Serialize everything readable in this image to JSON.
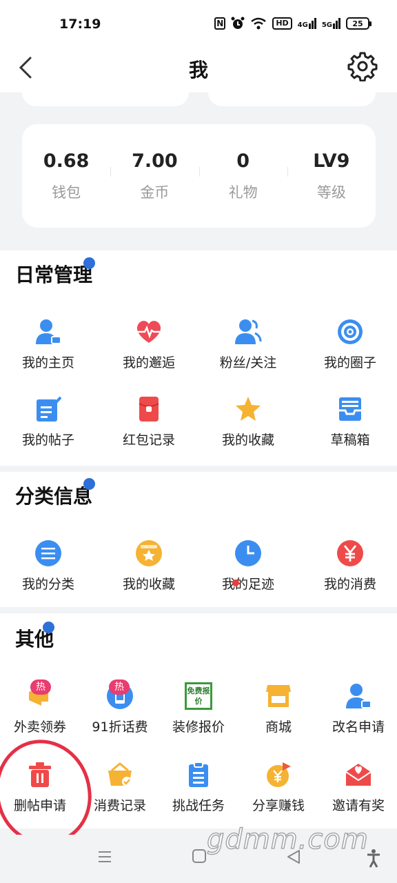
{
  "status_bar": {
    "time": "17:19",
    "hd_badge": "HD",
    "net1": "4G",
    "net2": "5G",
    "battery": "25"
  },
  "header": {
    "title": "我",
    "back_icon": "chevron-left-icon",
    "settings_icon": "gear-icon"
  },
  "stats": [
    {
      "value": "0.68",
      "label": "钱包"
    },
    {
      "value": "7.00",
      "label": "金币"
    },
    {
      "value": "0",
      "label": "礼物"
    },
    {
      "value": "LV9",
      "label": "等级"
    }
  ],
  "daily": {
    "title": "日常管理",
    "items": [
      {
        "label": "我的主页",
        "icon": "user-home-icon"
      },
      {
        "label": "我的邂逅",
        "icon": "heartbeat-icon"
      },
      {
        "label": "粉丝/关注",
        "icon": "fans-icon"
      },
      {
        "label": "我的圈子",
        "icon": "circle-target-icon"
      },
      {
        "label": "我的帖子",
        "icon": "edit-post-icon"
      },
      {
        "label": "红包记录",
        "icon": "red-envelope-icon"
      },
      {
        "label": "我的收藏",
        "icon": "star-icon"
      },
      {
        "label": "草稿箱",
        "icon": "inbox-tray-icon"
      }
    ]
  },
  "category": {
    "title": "分类信息",
    "items": [
      {
        "label": "我的分类",
        "icon": "list-icon"
      },
      {
        "label": "我的收藏",
        "icon": "star-bag-icon"
      },
      {
        "label": "我的足迹",
        "icon": "clock-icon"
      },
      {
        "label": "我的消费",
        "icon": "yuan-icon"
      }
    ]
  },
  "other": {
    "title": "其他",
    "hot_badge": "热",
    "items": [
      {
        "label": "外卖领券",
        "icon": "megaphone-icon"
      },
      {
        "label": "91折话费",
        "icon": "phone-bill-icon"
      },
      {
        "label": "装修报价",
        "icon": "free-quote-icon",
        "icon_text": "免费报价"
      },
      {
        "label": "商城",
        "icon": "shop-icon"
      },
      {
        "label": "改名申请",
        "icon": "user-rename-icon"
      },
      {
        "label": "删帖申请",
        "icon": "trash-icon"
      },
      {
        "label": "消费记录",
        "icon": "basket-icon"
      },
      {
        "label": "挑战任务",
        "icon": "clipboard-icon"
      },
      {
        "label": "分享赚钱",
        "icon": "share-money-icon"
      },
      {
        "label": "邀请有奖",
        "icon": "invite-envelope-icon"
      }
    ]
  },
  "watermark": "gdmm.com",
  "colors": {
    "blue": "#3b8ef0",
    "red": "#ef4a4a",
    "orange": "#f6b232",
    "annotation": "#e53045"
  }
}
